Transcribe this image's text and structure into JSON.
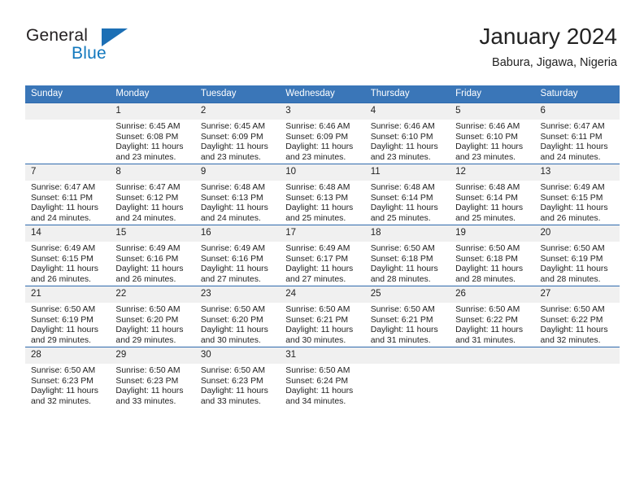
{
  "brand": {
    "name_part1": "General",
    "name_part2": "Blue",
    "accent_color": "#1c6fb5"
  },
  "header": {
    "title": "January 2024",
    "subtitle": "Babura, Jigawa, Nigeria"
  },
  "theme": {
    "header_row_bg": "#3a76b8",
    "row_divider": "#2f6aad",
    "daynum_bg": "#f0f0f0",
    "text": "#222222"
  },
  "calendar": {
    "weekday_headers": [
      "Sunday",
      "Monday",
      "Tuesday",
      "Wednesday",
      "Thursday",
      "Friday",
      "Saturday"
    ],
    "weeks": [
      [
        {
          "day": "",
          "lines": []
        },
        {
          "day": "1",
          "lines": [
            "Sunrise: 6:45 AM",
            "Sunset: 6:08 PM",
            "Daylight: 11 hours",
            "and 23 minutes."
          ]
        },
        {
          "day": "2",
          "lines": [
            "Sunrise: 6:45 AM",
            "Sunset: 6:09 PM",
            "Daylight: 11 hours",
            "and 23 minutes."
          ]
        },
        {
          "day": "3",
          "lines": [
            "Sunrise: 6:46 AM",
            "Sunset: 6:09 PM",
            "Daylight: 11 hours",
            "and 23 minutes."
          ]
        },
        {
          "day": "4",
          "lines": [
            "Sunrise: 6:46 AM",
            "Sunset: 6:10 PM",
            "Daylight: 11 hours",
            "and 23 minutes."
          ]
        },
        {
          "day": "5",
          "lines": [
            "Sunrise: 6:46 AM",
            "Sunset: 6:10 PM",
            "Daylight: 11 hours",
            "and 23 minutes."
          ]
        },
        {
          "day": "6",
          "lines": [
            "Sunrise: 6:47 AM",
            "Sunset: 6:11 PM",
            "Daylight: 11 hours",
            "and 24 minutes."
          ]
        }
      ],
      [
        {
          "day": "7",
          "lines": [
            "Sunrise: 6:47 AM",
            "Sunset: 6:11 PM",
            "Daylight: 11 hours",
            "and 24 minutes."
          ]
        },
        {
          "day": "8",
          "lines": [
            "Sunrise: 6:47 AM",
            "Sunset: 6:12 PM",
            "Daylight: 11 hours",
            "and 24 minutes."
          ]
        },
        {
          "day": "9",
          "lines": [
            "Sunrise: 6:48 AM",
            "Sunset: 6:13 PM",
            "Daylight: 11 hours",
            "and 24 minutes."
          ]
        },
        {
          "day": "10",
          "lines": [
            "Sunrise: 6:48 AM",
            "Sunset: 6:13 PM",
            "Daylight: 11 hours",
            "and 25 minutes."
          ]
        },
        {
          "day": "11",
          "lines": [
            "Sunrise: 6:48 AM",
            "Sunset: 6:14 PM",
            "Daylight: 11 hours",
            "and 25 minutes."
          ]
        },
        {
          "day": "12",
          "lines": [
            "Sunrise: 6:48 AM",
            "Sunset: 6:14 PM",
            "Daylight: 11 hours",
            "and 25 minutes."
          ]
        },
        {
          "day": "13",
          "lines": [
            "Sunrise: 6:49 AM",
            "Sunset: 6:15 PM",
            "Daylight: 11 hours",
            "and 26 minutes."
          ]
        }
      ],
      [
        {
          "day": "14",
          "lines": [
            "Sunrise: 6:49 AM",
            "Sunset: 6:15 PM",
            "Daylight: 11 hours",
            "and 26 minutes."
          ]
        },
        {
          "day": "15",
          "lines": [
            "Sunrise: 6:49 AM",
            "Sunset: 6:16 PM",
            "Daylight: 11 hours",
            "and 26 minutes."
          ]
        },
        {
          "day": "16",
          "lines": [
            "Sunrise: 6:49 AM",
            "Sunset: 6:16 PM",
            "Daylight: 11 hours",
            "and 27 minutes."
          ]
        },
        {
          "day": "17",
          "lines": [
            "Sunrise: 6:49 AM",
            "Sunset: 6:17 PM",
            "Daylight: 11 hours",
            "and 27 minutes."
          ]
        },
        {
          "day": "18",
          "lines": [
            "Sunrise: 6:50 AM",
            "Sunset: 6:18 PM",
            "Daylight: 11 hours",
            "and 28 minutes."
          ]
        },
        {
          "day": "19",
          "lines": [
            "Sunrise: 6:50 AM",
            "Sunset: 6:18 PM",
            "Daylight: 11 hours",
            "and 28 minutes."
          ]
        },
        {
          "day": "20",
          "lines": [
            "Sunrise: 6:50 AM",
            "Sunset: 6:19 PM",
            "Daylight: 11 hours",
            "and 28 minutes."
          ]
        }
      ],
      [
        {
          "day": "21",
          "lines": [
            "Sunrise: 6:50 AM",
            "Sunset: 6:19 PM",
            "Daylight: 11 hours",
            "and 29 minutes."
          ]
        },
        {
          "day": "22",
          "lines": [
            "Sunrise: 6:50 AM",
            "Sunset: 6:20 PM",
            "Daylight: 11 hours",
            "and 29 minutes."
          ]
        },
        {
          "day": "23",
          "lines": [
            "Sunrise: 6:50 AM",
            "Sunset: 6:20 PM",
            "Daylight: 11 hours",
            "and 30 minutes."
          ]
        },
        {
          "day": "24",
          "lines": [
            "Sunrise: 6:50 AM",
            "Sunset: 6:21 PM",
            "Daylight: 11 hours",
            "and 30 minutes."
          ]
        },
        {
          "day": "25",
          "lines": [
            "Sunrise: 6:50 AM",
            "Sunset: 6:21 PM",
            "Daylight: 11 hours",
            "and 31 minutes."
          ]
        },
        {
          "day": "26",
          "lines": [
            "Sunrise: 6:50 AM",
            "Sunset: 6:22 PM",
            "Daylight: 11 hours",
            "and 31 minutes."
          ]
        },
        {
          "day": "27",
          "lines": [
            "Sunrise: 6:50 AM",
            "Sunset: 6:22 PM",
            "Daylight: 11 hours",
            "and 32 minutes."
          ]
        }
      ],
      [
        {
          "day": "28",
          "lines": [
            "Sunrise: 6:50 AM",
            "Sunset: 6:23 PM",
            "Daylight: 11 hours",
            "and 32 minutes."
          ]
        },
        {
          "day": "29",
          "lines": [
            "Sunrise: 6:50 AM",
            "Sunset: 6:23 PM",
            "Daylight: 11 hours",
            "and 33 minutes."
          ]
        },
        {
          "day": "30",
          "lines": [
            "Sunrise: 6:50 AM",
            "Sunset: 6:23 PM",
            "Daylight: 11 hours",
            "and 33 minutes."
          ]
        },
        {
          "day": "31",
          "lines": [
            "Sunrise: 6:50 AM",
            "Sunset: 6:24 PM",
            "Daylight: 11 hours",
            "and 34 minutes."
          ]
        },
        {
          "day": "",
          "lines": []
        },
        {
          "day": "",
          "lines": []
        },
        {
          "day": "",
          "lines": []
        }
      ]
    ]
  }
}
